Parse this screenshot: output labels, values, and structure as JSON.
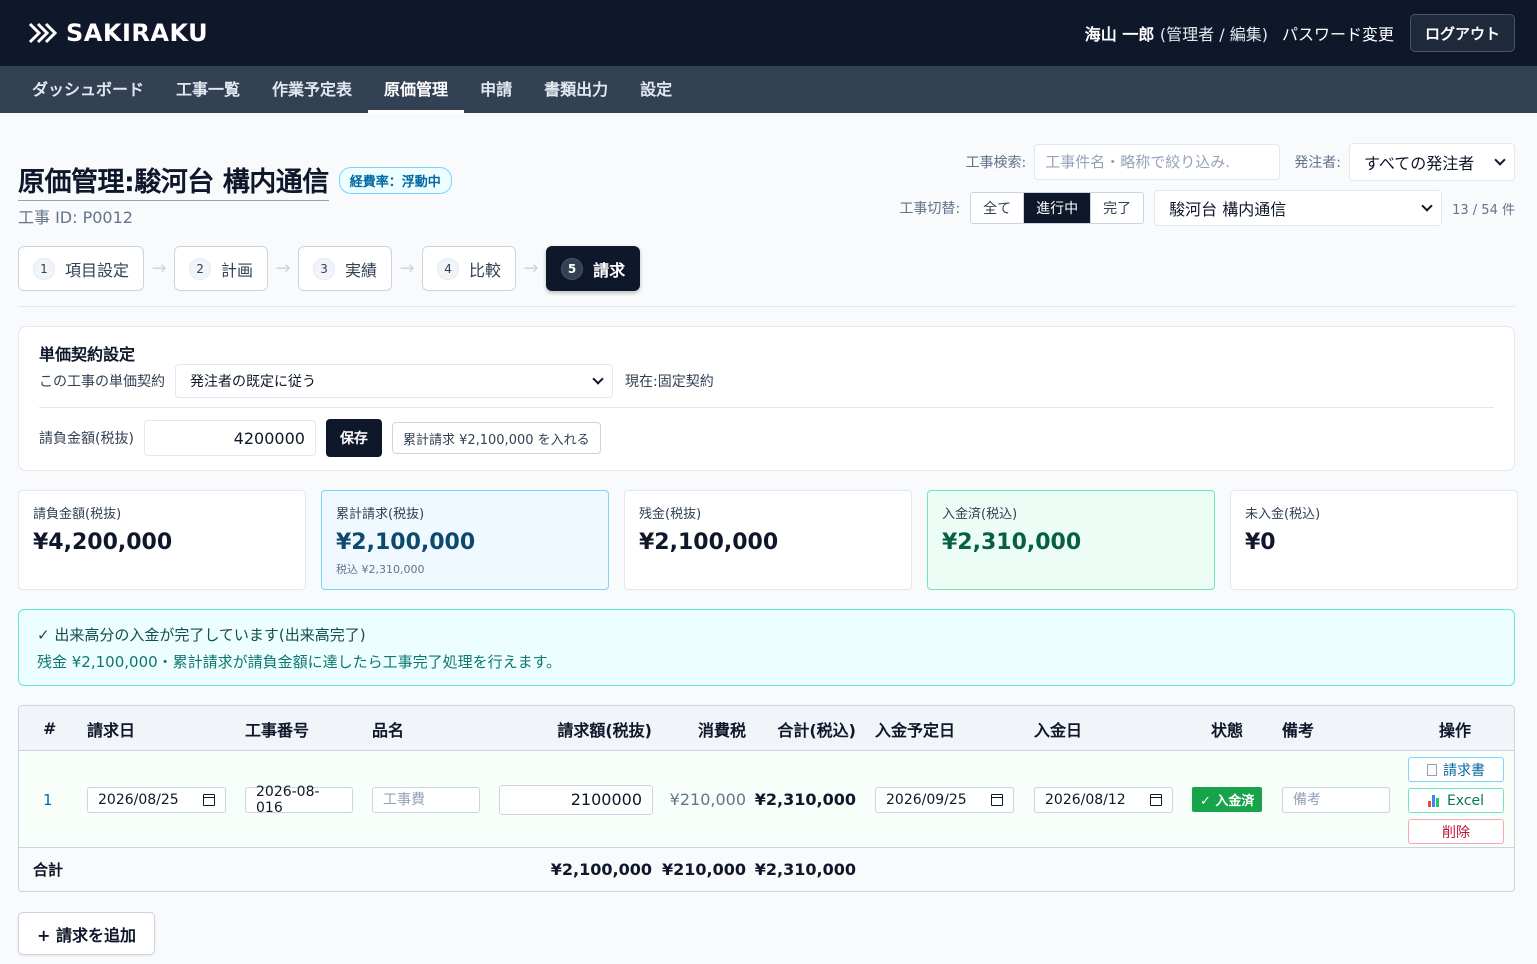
{
  "app": {
    "logo_text": "SAKIRAKU"
  },
  "header": {
    "user_name": "海山 一郎",
    "user_role": "(管理者 / 編集)",
    "password_link": "パスワード変更",
    "logout_label": "ログアウト"
  },
  "nav": {
    "items": [
      {
        "label": "ダッシュボード"
      },
      {
        "label": "工事一覧"
      },
      {
        "label": "作業予定表"
      },
      {
        "label": "原価管理"
      },
      {
        "label": "申請"
      },
      {
        "label": "書類出力"
      },
      {
        "label": "設定"
      }
    ],
    "active_index": 3
  },
  "page": {
    "title": "原価管理:駿河台 構内通信",
    "rate_badge": "経費率：浮動中",
    "project_id": "工事 ID: P0012"
  },
  "filters": {
    "search_label": "工事検索:",
    "search_placeholder": "工事件名・略称で絞り込み.",
    "client_label": "発注者:",
    "client_value": "すべての発注者",
    "switch_label": "工事切替:",
    "switch_options": [
      {
        "label": "全て"
      },
      {
        "label": "進行中"
      },
      {
        "label": "完了"
      }
    ],
    "switch_active_index": 1,
    "project_value": "駿河台 構内通信",
    "count": "13 / 54 件"
  },
  "steps": [
    {
      "num": "1",
      "label": "項目設定"
    },
    {
      "num": "2",
      "label": "計画"
    },
    {
      "num": "3",
      "label": "実績"
    },
    {
      "num": "4",
      "label": "比較"
    },
    {
      "num": "5",
      "label": "請求"
    }
  ],
  "steps_active_index": 4,
  "contract": {
    "heading": "単価契約設定",
    "unit_label": "この工事の単価契約",
    "unit_value": "発注者の既定に従う",
    "current": "現在:固定契約",
    "amount_label": "請負金額(税抜)",
    "amount_value": "4200000",
    "save_label": "保存",
    "fill_button": "累計請求 ¥2,100,000 を入れる"
  },
  "cards": [
    {
      "label": "請負金額(税抜)",
      "value": "¥4,200,000",
      "sub": ""
    },
    {
      "label": "累計請求(税抜)",
      "value": "¥2,100,000",
      "sub": "税込 ¥2,310,000"
    },
    {
      "label": "残金(税抜)",
      "value": "¥2,100,000",
      "sub": ""
    },
    {
      "label": "入金済(税込)",
      "value": "¥2,310,000",
      "sub": ""
    },
    {
      "label": "未入金(税込)",
      "value": "¥0",
      "sub": ""
    }
  ],
  "notice": {
    "title": "✓ 出来高分の入金が完了しています(出来高完了)",
    "body": "残金 ¥2,100,000・累計請求が請負金額に達したら工事完了処理を行えます。"
  },
  "table": {
    "headers": {
      "no": "#",
      "date": "請求日",
      "number": "工事番号",
      "item": "品名",
      "amount": "請求額(税抜)",
      "tax": "消費税",
      "total": "合計(税込)",
      "due": "入金予定日",
      "paid": "入金日",
      "status": "状態",
      "note": "備考",
      "ops": "操作"
    },
    "rows": [
      {
        "no": "1",
        "date": "2026/08/25",
        "number": "2026-08-016",
        "item_placeholder": "工事費",
        "amount": "2100000",
        "tax": "¥210,000",
        "total": "¥2,310,000",
        "due": "2026/09/25",
        "paid": "2026/08/12",
        "status": "✓ 入金済",
        "note_placeholder": "備考",
        "op_invoice": "請求書",
        "op_excel": "Excel",
        "op_delete": "削除"
      }
    ],
    "footer": {
      "label": "合計",
      "amount": "¥2,100,000",
      "tax": "¥210,000",
      "total": "¥2,310,000"
    }
  },
  "add_button": "+ 請求を追加"
}
